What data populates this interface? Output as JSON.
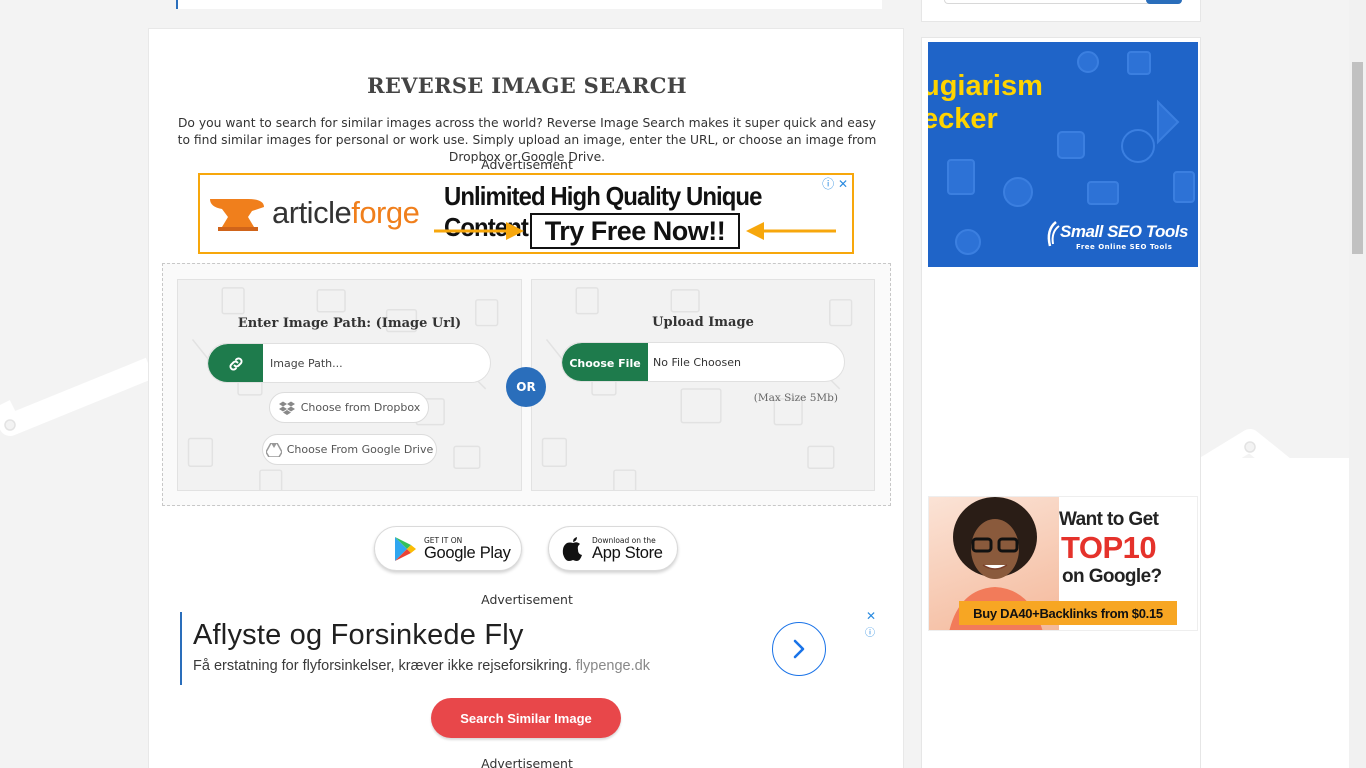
{
  "page": {
    "title": "REVERSE IMAGE SEARCH",
    "intro": "Do you want to search for similar images across the world? Reverse Image Search makes it super quick and easy to find similar images for personal or work use. Simply upload an image, enter the URL, or choose an image from Dropbox or Google Drive."
  },
  "ads": {
    "label": "Advertisement",
    "banner": {
      "brand_prefix": "article",
      "brand_suffix": "forge",
      "headline": "Unlimited High Quality Unique Content",
      "cta": "Try Free Now!!",
      "choices": "ⓘ ✕"
    },
    "text_ad": {
      "title": "Aflyste og Forsinkede Fly",
      "description": "Få erstatning for flyforsinkelser, kræver ikke rejseforsikring.",
      "domain": "flypenge.dk",
      "close": "✕",
      "info": "ⓘ"
    },
    "sidebar_ad1": {
      "headline_line1": "ugiarism",
      "headline_line2": "ecker",
      "brand": "Small SEO Tools",
      "sub": "Free Online SEO Tools"
    },
    "sidebar_ad2": {
      "line1": "Want to Get",
      "line2": "TOP10",
      "line3": "on Google?",
      "offer": "Buy DA40+Backlinks from $0.15"
    }
  },
  "url_panel": {
    "title": "Enter Image Path: (Image Url)",
    "placeholder": "Image Path...",
    "dropbox_label": "Choose from Dropbox",
    "gdrive_label": "Choose From Google Drive"
  },
  "or_label": "OR",
  "upload_panel": {
    "title": "Upload Image",
    "choose_label": "Choose File",
    "file_status": "No File Choosen",
    "max_size": "(Max Size 5Mb)"
  },
  "stores": {
    "google_small": "GET IT ON",
    "google_big": "Google Play",
    "apple_small": "Download on the",
    "apple_big": "App Store"
  },
  "search_button": "Search Similar Image",
  "colors": {
    "primary_green": "#1e7b4c",
    "accent_blue": "#2a6ebb",
    "search_red": "#e8474a",
    "banner_orange": "#f7a70c"
  }
}
